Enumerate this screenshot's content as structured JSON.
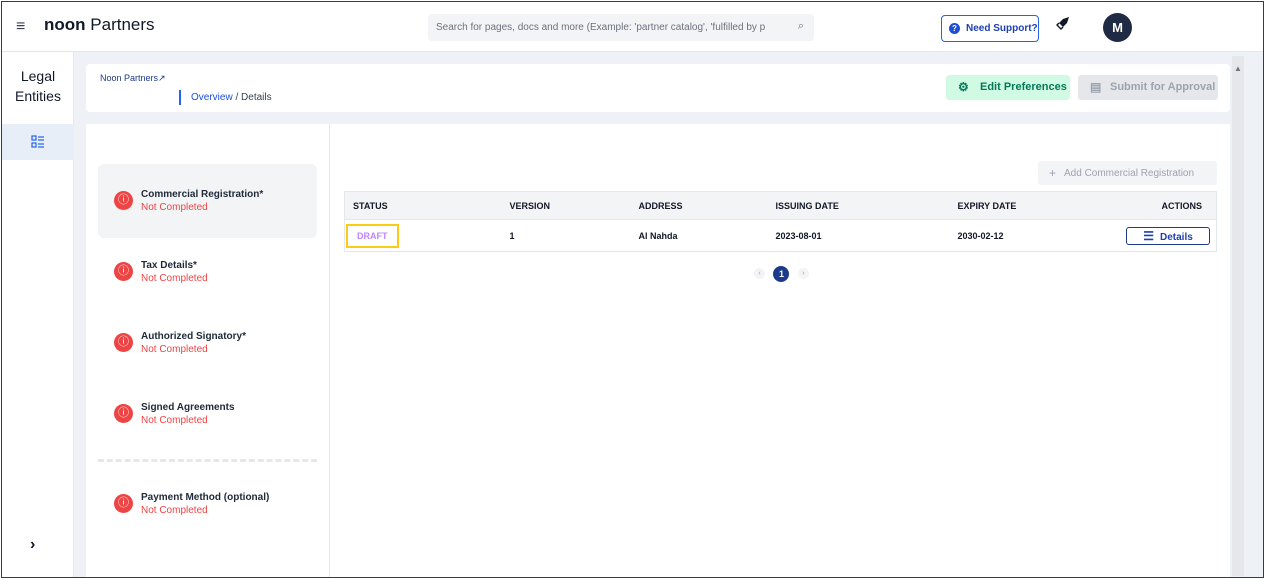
{
  "topbar": {
    "brand_bold": "noon",
    "brand_light": "Partners",
    "search_placeholder": "Search for pages, docs and more (Example: 'partner catalog', 'fulfilled by p",
    "support_label": "Need Support?",
    "avatar_initial": "M"
  },
  "rail": {
    "title_line1": "Legal",
    "title_line2": "Entities"
  },
  "header": {
    "breadcrumb_root": "Noon Partners",
    "breadcrumb_overview": "Overview",
    "breadcrumb_sep": "/",
    "breadcrumb_current": "Details",
    "edit_preferences_label": "Edit Preferences",
    "submit_label": "Submit for Approval"
  },
  "steps": [
    {
      "title": "Commercial Registration*",
      "status": "Not Completed"
    },
    {
      "title": "Tax Details*",
      "status": "Not Completed"
    },
    {
      "title": "Authorized Signatory*",
      "status": "Not Completed"
    },
    {
      "title": "Signed Agreements",
      "status": "Not Completed"
    },
    {
      "title": "Payment Method (optional)",
      "status": "Not Completed"
    }
  ],
  "main": {
    "add_button_label": "Add Commercial Registration",
    "columns": [
      "STATUS",
      "VERSION",
      "ADDRESS",
      "ISSUING DATE",
      "EXPIRY DATE",
      "ACTIONS"
    ],
    "rows": [
      {
        "status": "DRAFT",
        "version": "1",
        "address": "Al Nahda",
        "issuing_date": "2023-08-01",
        "expiry_date": "2030-02-12",
        "action": "Details"
      }
    ],
    "pagination": {
      "current_page": "1",
      "prev": "‹",
      "next": "›"
    }
  },
  "colors": {
    "accent": "#1e3a8a",
    "error": "#ef4444",
    "success_bg": "#d1fae5",
    "highlight": "#facc15"
  }
}
